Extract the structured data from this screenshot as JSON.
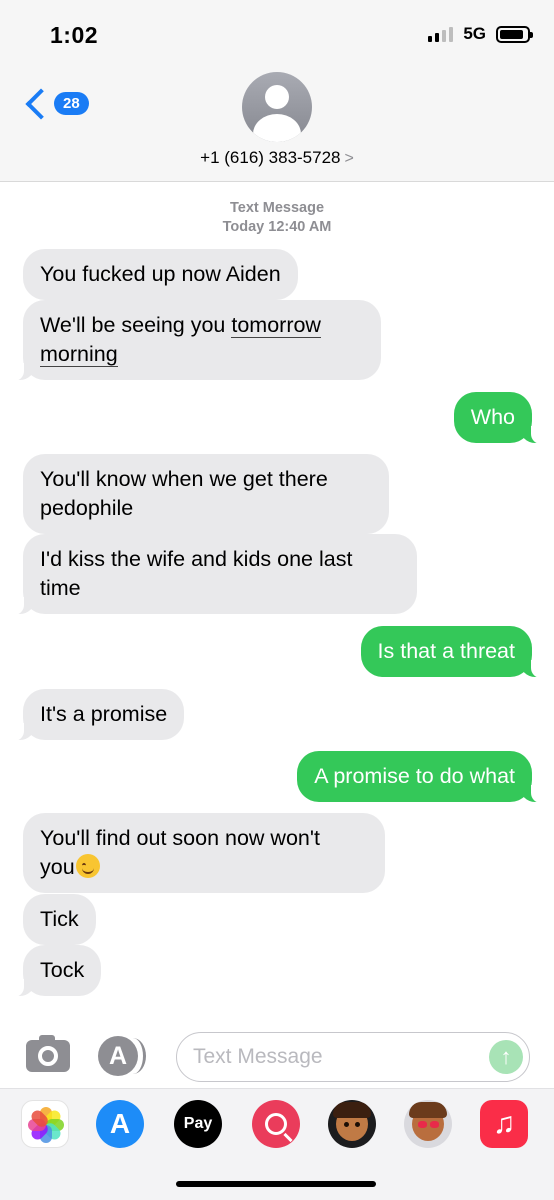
{
  "status_bar": {
    "time": "1:02",
    "network": "5G"
  },
  "header": {
    "back_count": "28",
    "contact_number": "+1 (616) 383-5728",
    "contact_arrow": ">"
  },
  "conversation": {
    "service": "Text Message",
    "timestamp": "Today 12:40 AM",
    "messages": [
      {
        "from": "them",
        "text": "You fucked up now Aiden"
      },
      {
        "from": "them",
        "text_before": "We'll be seeing you ",
        "text_link1": "tomorrow",
        "text_link2": "morning"
      },
      {
        "from": "me",
        "text": "Who"
      },
      {
        "from": "them",
        "line1": "You'll know when we get there",
        "line2": "pedophile"
      },
      {
        "from": "them",
        "line1": "I'd kiss the wife and kids one last",
        "line2": "time"
      },
      {
        "from": "me",
        "text": "Is that a threat"
      },
      {
        "from": "them",
        "text": "It's a promise"
      },
      {
        "from": "me",
        "text": "A promise to do what"
      },
      {
        "from": "them",
        "line1": "You'll find out soon now won't",
        "line2": "you",
        "emoji": "winking-face"
      },
      {
        "from": "them",
        "text": "Tick"
      },
      {
        "from": "them",
        "text": "Tock"
      }
    ]
  },
  "composer": {
    "placeholder": "Text Message",
    "appstore_glyph": "A",
    "send_glyph": "↑"
  },
  "app_drawer": {
    "apple_pay_label": "Pay",
    "apple_glyph": "",
    "store_glyph": "A",
    "music_glyph": "♫"
  },
  "colors": {
    "incoming": "#e9e9eb",
    "outgoing": "#34c859",
    "accent": "#1a7cf5"
  }
}
